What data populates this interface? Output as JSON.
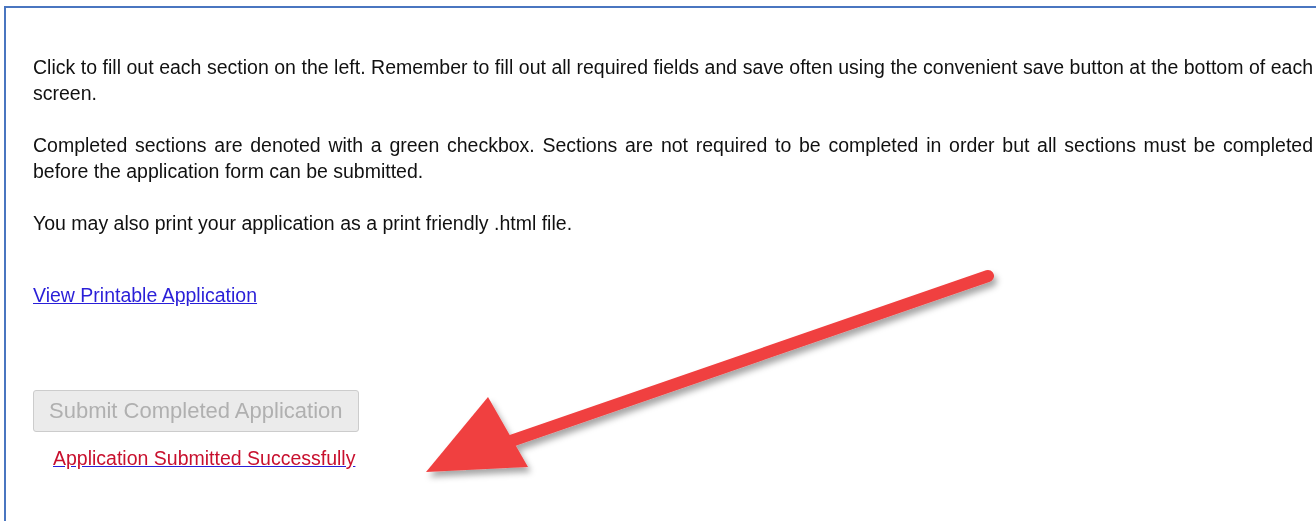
{
  "paragraphs": [
    "Click to fill out each section on the left. Remember to fill out all required fields and save often using the convenient save button at the bottom of each screen.",
    "Completed sections are denoted with a green checkbox. Sections are not required to be completed in order but all sections must be completed before the application form can be submitted.",
    "You may also print your application as a print friendly .html file."
  ],
  "printable_link": "View Printable Application",
  "submit_button": {
    "label": "Submit Completed Application",
    "disabled": true
  },
  "status_link": "Application Submitted Successfully"
}
